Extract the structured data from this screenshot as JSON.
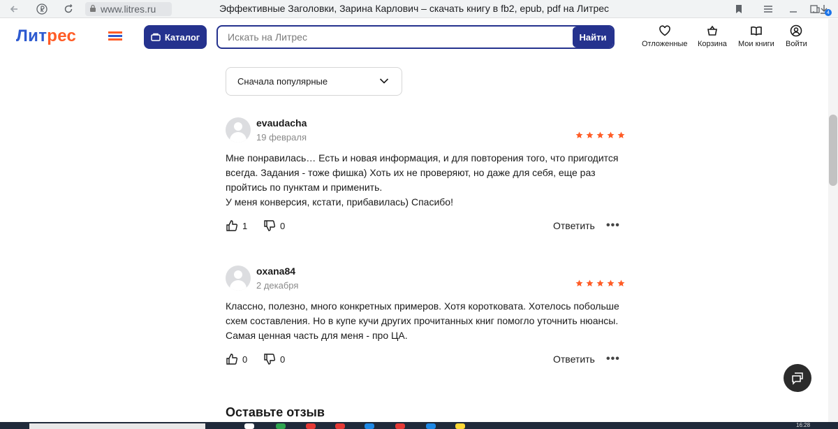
{
  "browser": {
    "url": "www.litres.ru",
    "title": "Эффективные Заголовки, Зарина Карлович – скачать книгу в fb2, epub, pdf на Литрес",
    "downloads_badge": "4"
  },
  "header": {
    "logo_main": "Лит",
    "logo_accent": "рес",
    "catalog_label": "Каталог",
    "search_placeholder": "Искать на Литрес",
    "search_button": "Найти",
    "actions": {
      "saved": "Отложенные",
      "cart": "Корзина",
      "my_books": "Мои книги",
      "login": "Войти"
    }
  },
  "sort": {
    "selected": "Сначала популярные"
  },
  "reviews": [
    {
      "name": "evaudacha",
      "date": "19 февраля",
      "rating": 5,
      "text_lines": [
        "Мне понравилась… Есть и новая информация, и для повторения того, что пригодится всегда. Задания - тоже фишка) Хоть их не проверяют, но даже для себя, еще раз пройтись по пунктам и применить.",
        "У меня конверсия, кстати, прибавилась) Спасибо!"
      ],
      "likes": "1",
      "dislikes": "0",
      "reply_label": "Ответить"
    },
    {
      "name": "oxana84",
      "date": "2 декабря",
      "rating": 5,
      "text_lines": [
        "Классно, полезно, много конкретных примеров. Хотя коротковата. Хотелось побольше схем составления. Но в купе кучи других прочитанных книг помогло уточнить нюансы. Самая ценная часть для меня - про ЦА."
      ],
      "likes": "0",
      "dislikes": "0",
      "reply_label": "Ответить"
    }
  ],
  "leave_review_heading": "Оставьте отзыв",
  "taskbar": {
    "time": "16:28"
  },
  "colors": {
    "brand_blue": "#25328e",
    "logo_blue": "#2d5ad0",
    "accent_orange": "#ff5c26",
    "star": "#ff5c26"
  }
}
